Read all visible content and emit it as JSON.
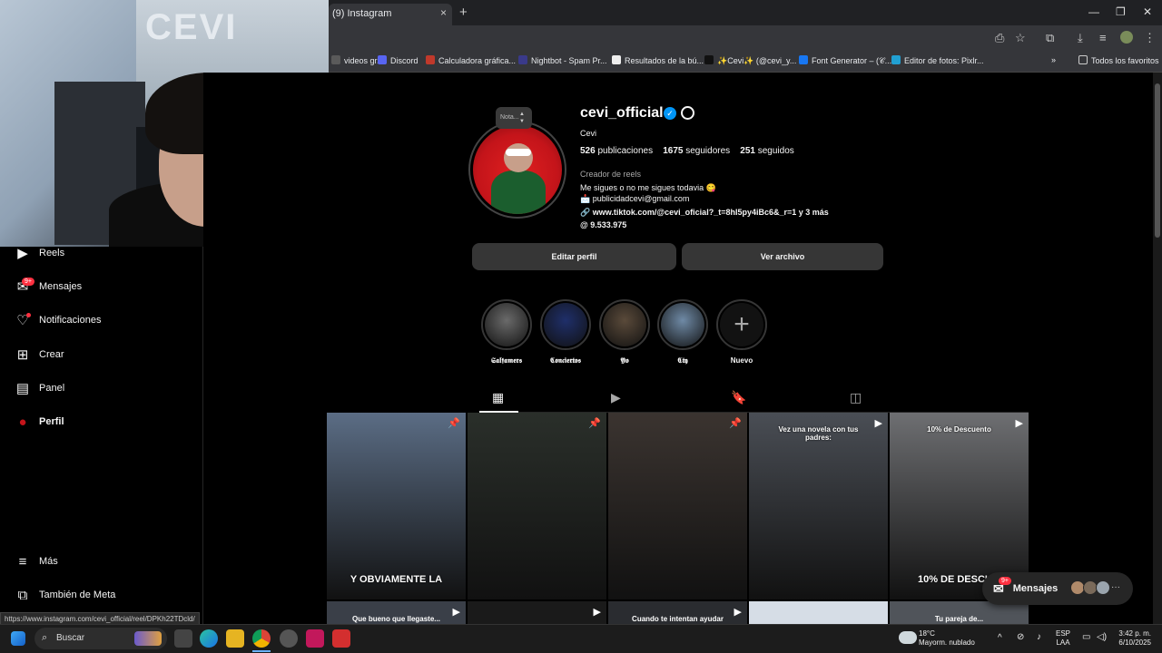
{
  "browser": {
    "tab_title": "(9) Instagram",
    "tab_close": "×",
    "new_tab": "+",
    "win_min": "—",
    "win_restore": "❐",
    "win_close": "✕",
    "bookmarks": [
      {
        "label": "videos gr...",
        "color": "#5a5a5a"
      },
      {
        "label": "Discord",
        "color": "#5865f2"
      },
      {
        "label": "Calculadora gráfica...",
        "color": "#c0392b"
      },
      {
        "label": "Nightbot - Spam Pr...",
        "color": "#3a3a8a"
      },
      {
        "label": "Resultados de la bú...",
        "color": "#eeeeee"
      },
      {
        "label": "✨Cevi✨ (@cevi_y...",
        "color": "#111111"
      },
      {
        "label": "Font Generator – (𝒞...",
        "color": "#1877f2"
      },
      {
        "label": "Editor de fotos: Pixlr...",
        "color": "#21a0d2"
      }
    ],
    "bookmarks_more": "»",
    "all_favorites": "Todos los favoritos"
  },
  "sidebar": {
    "items": [
      {
        "label": "Reels",
        "icon": "reels-icon",
        "glyph": "▶"
      },
      {
        "label": "Mensajes",
        "icon": "messenger-icon",
        "glyph": "✉"
      },
      {
        "label": "Notificaciones",
        "icon": "heart-icon",
        "glyph": "♡"
      },
      {
        "label": "Crear",
        "icon": "plus-square-icon",
        "glyph": "⊞"
      },
      {
        "label": "Panel",
        "icon": "dashboard-icon",
        "glyph": "▤"
      },
      {
        "label": "Perfil",
        "icon": "profile-avatar-icon",
        "glyph": "●"
      }
    ],
    "messages_badge": "9+",
    "more": {
      "label": "Más",
      "glyph": "≡"
    },
    "meta": {
      "label": "También de Meta",
      "glyph": "⧉"
    }
  },
  "profile": {
    "note": "Nota...",
    "username": "cevi_official",
    "verified_glyph": "✓",
    "full_name": "Cevi",
    "posts_count": "526",
    "posts_label": "publicaciones",
    "followers_count": "1675",
    "followers_label": "seguidores",
    "following_count": "251",
    "following_label": "seguidos",
    "category": "Creador de reels",
    "bio_line1": "Me sigues o no me sigues todavia 😋",
    "bio_line2": "📩 publicidadcevi@gmail.com",
    "link": "🔗 www.tiktok.com/@cevi_oficial?_t=8hI5py4iBc6&_r=1 y 3 más",
    "threads": "@ 9.533.975",
    "edit_button": "Editar perfil",
    "archive_button": "Ver archivo"
  },
  "highlights": [
    {
      "label": "𝕾𝖆𝖑𝖋𝖆𝖒𝖊𝖗𝖘",
      "color": "#6a6a6a"
    },
    {
      "label": "𝕮𝖔𝖓𝖈𝖎𝖊𝖗𝖙𝖔𝖘",
      "color": "#1f2f6a"
    },
    {
      "label": "𝖄𝖔",
      "color": "#5a4a3a"
    },
    {
      "label": "𝕮𝖙𝖞",
      "color": "#6f8aa6"
    }
  ],
  "new_highlight": {
    "label": "Nuevo",
    "glyph": "+"
  },
  "tabs": {
    "posts": "▦",
    "reels": "▶",
    "saved": "🔖",
    "tagged": "◫"
  },
  "posts": [
    {
      "caption": "Y OBVIAMENTE LA",
      "top_caption": "",
      "badge": "📌",
      "color": "#5b6d85"
    },
    {
      "caption": "",
      "top_caption": "",
      "badge": "📌",
      "color": "#2a2f2a"
    },
    {
      "caption": "",
      "top_caption": "",
      "badge": "📌",
      "color": "#3b3430"
    },
    {
      "caption": "",
      "top_caption": "Vez una novela con tus padres:",
      "badge": "▶",
      "color": "#4a4e55"
    },
    {
      "caption": "10% DE DESCU...",
      "top_caption": "10% de Descuento",
      "badge": "▶",
      "color": "#6e6f72"
    }
  ],
  "posts_row2": [
    {
      "caption": "Que bueno que llegaste...",
      "badge": "▶",
      "color": "#3a3f48"
    },
    {
      "caption": "",
      "badge": "▶",
      "color": "#1a1a1a"
    },
    {
      "caption": "Cuando te intentan ayudar",
      "badge": "▶",
      "color": "#2a2c30"
    },
    {
      "caption": "",
      "badge": "",
      "color": "#d6dde6"
    },
    {
      "caption": "Tu pareja de...",
      "badge": "",
      "color": "#50545a"
    }
  ],
  "messages_pill": {
    "label": "Mensajes",
    "badge": "9+",
    "more": "···"
  },
  "status_url": "https://www.instagram.com/cevi_official/reel/DPKh22TDcld/",
  "taskbar": {
    "search": "Buscar",
    "weather_temp": "18°C",
    "weather_desc": "Mayorm. nublado",
    "lang1": "ESP",
    "lang2": "LAA",
    "time": "3:42 p. m.",
    "date": "6/10/2025"
  }
}
